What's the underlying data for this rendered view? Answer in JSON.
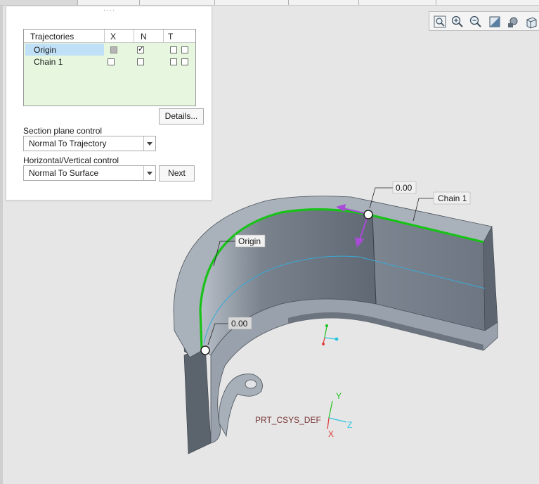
{
  "panel": {
    "grip": "····",
    "table": {
      "headers": {
        "trajectories": "Trajectories",
        "x": "X",
        "n": "N",
        "t": "T"
      },
      "rows": [
        {
          "name": "Origin",
          "x": "partial",
          "n": true,
          "t": [
            false,
            false
          ],
          "selected": true
        },
        {
          "name": "Chain 1",
          "x": false,
          "n": false,
          "t": [
            false,
            false
          ],
          "selected": false
        }
      ]
    },
    "details_button": "Details...",
    "section_plane_label": "Section plane control",
    "section_plane_value": "Normal To Trajectory",
    "hv_label": "Horizontal/Vertical control",
    "hv_value": "Normal To Surface",
    "next_button": "Next"
  },
  "toolbar": {
    "icons": [
      "zoom-fit-icon",
      "zoom-in-icon",
      "zoom-out-icon",
      "repaint-icon",
      "render-style-icon",
      "view-cube-icon"
    ]
  },
  "model": {
    "origin_tag": "Origin",
    "chain_tag": "Chain 1",
    "start_value_top": "0.00",
    "start_value_bottom": "0.00",
    "csys_name": "PRT_CSYS_DEF",
    "axis_x": "X",
    "axis_y": "Y",
    "axis_z": "Z"
  },
  "colors": {
    "trajectory_green": "#19c219",
    "sweep_purple": "#a84bd6",
    "part_body": "#8d97a3",
    "selection_blue": "#bfe0f6",
    "table_bg": "#e7f7df"
  }
}
